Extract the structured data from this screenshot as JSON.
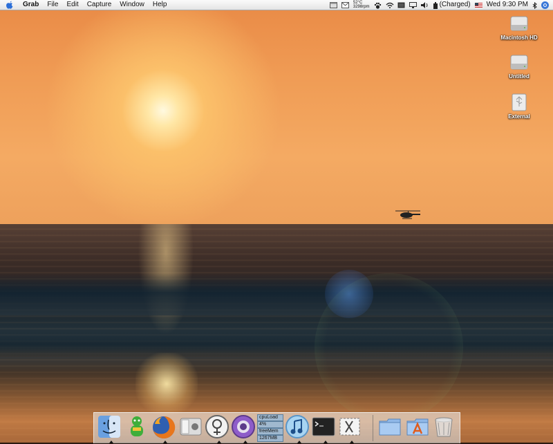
{
  "menubar": {
    "app_name": "Grab",
    "menus": [
      "File",
      "Edit",
      "Capture",
      "Window",
      "Help"
    ],
    "status": {
      "temperature": "52°C",
      "fan_speed": "3298rpm",
      "battery": "(Charged)",
      "clock": "Wed 9:30 PM"
    }
  },
  "desktop": {
    "icons": [
      {
        "label": "Macintosh HD",
        "icon": "hard-disk-icon"
      },
      {
        "label": "Untitled",
        "icon": "hard-disk-icon"
      },
      {
        "label": "External",
        "icon": "usb-drive-icon"
      }
    ]
  },
  "dock": {
    "items": [
      "finder-icon",
      "adium-icon",
      "firefox-icon",
      "apple-remote-desktop-icon",
      "ical-icon",
      "growl-icon",
      "cpu-monitor-widget",
      "itunes-icon",
      "terminal-icon",
      "grab-icon",
      "folder-icon",
      "applications-folder-icon",
      "trash-icon"
    ],
    "cpu_widget": {
      "cpu_label": "cpuLoad",
      "cpu_value": "4%",
      "mem_label": "freeMem",
      "mem_value": "1267MB"
    }
  },
  "colors": {
    "sky": "#f09c55",
    "sea": "#2c2626",
    "menubar": "#f0f0f0",
    "spotlight": "#3a78d8"
  }
}
